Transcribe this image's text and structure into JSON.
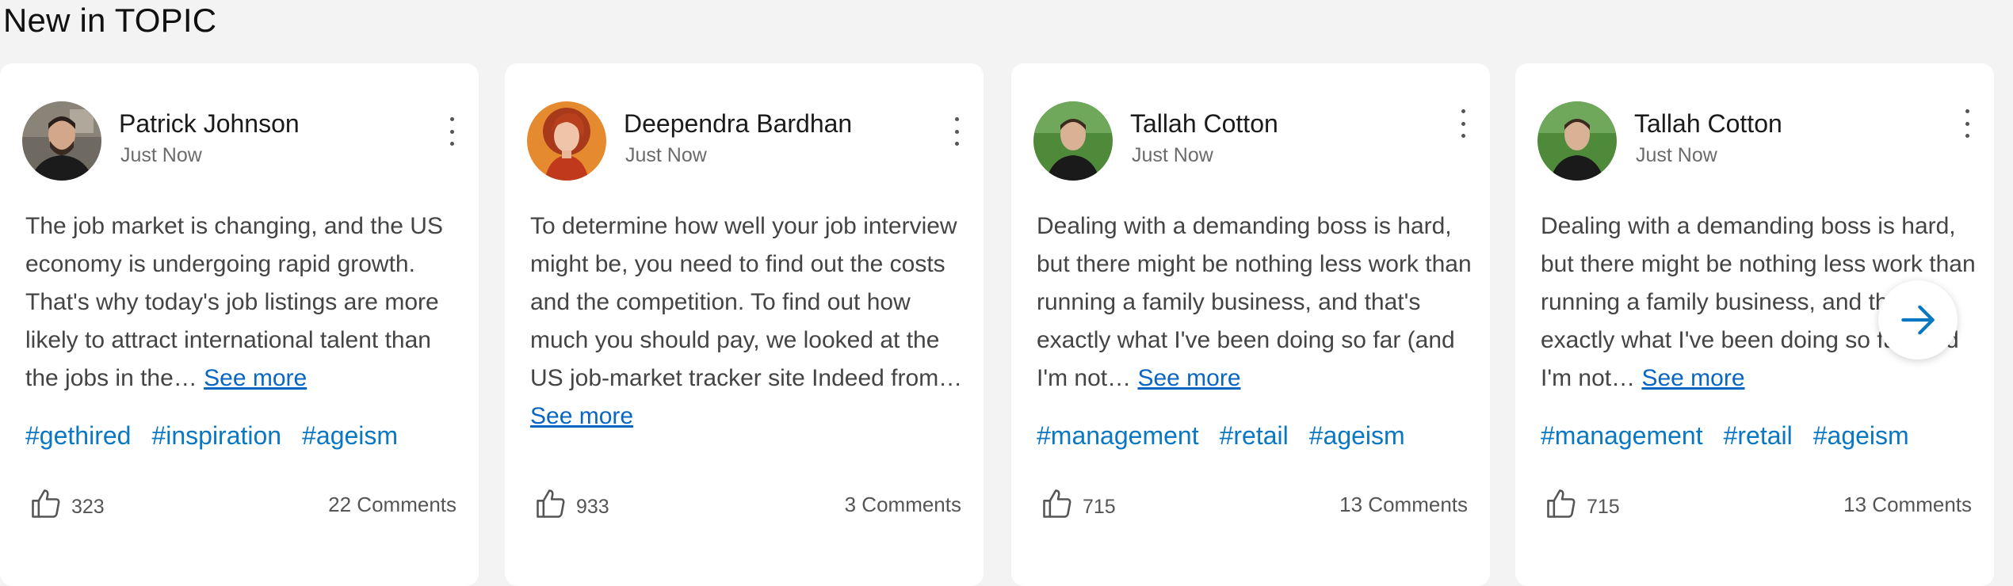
{
  "section": {
    "title": "New in TOPIC"
  },
  "colors": {
    "link": "#0a66c2",
    "tag": "#0a77c2",
    "card": "#ffffff",
    "page": "#f3f3f3"
  },
  "cards": [
    {
      "author": "Patrick Johnson",
      "time": "Just Now",
      "body": "The job market is changing, and the US economy is undergoing rapid growth. That's why today's job listings are more likely to attract international talent than the jobs in the…",
      "see_more": "See more",
      "tags": [
        "#gethired",
        "#inspiration",
        "#ageism"
      ],
      "likes": "323",
      "comments": "22 Comments"
    },
    {
      "author": "Deependra Bardhan",
      "time": "Just Now",
      "body": "To determine how well your job interview might be, you need to find out the costs and the competition. To find out how much you should pay, we looked at the US job-market tracker site Indeed from…",
      "see_more": "See more",
      "tags": [],
      "likes": "933",
      "comments": "3 Comments"
    },
    {
      "author": "Tallah Cotton",
      "time": "Just Now",
      "body": "Dealing with a demanding boss is hard, but  there might be nothing less work than running a family business, and that's exactly what I've been doing so far (and I'm not…",
      "see_more": "See more",
      "tags": [
        "#management",
        "#retail",
        "#ageism"
      ],
      "likes": "715",
      "comments": "13 Comments"
    },
    {
      "author": "Tallah Cotton",
      "time": "Just Now",
      "body": "Dealing with a demanding boss is hard, but  there might be nothing less work than running a family business, and that's exactly what I've been doing so far (and I'm not…",
      "see_more": "See more",
      "tags": [
        "#management",
        "#retail",
        "#ageism"
      ],
      "likes": "715",
      "comments": "13 Comments"
    }
  ],
  "icons": {
    "like": "thumbs-up-icon",
    "menu": "more-vertical-icon",
    "next": "arrow-right-icon"
  }
}
